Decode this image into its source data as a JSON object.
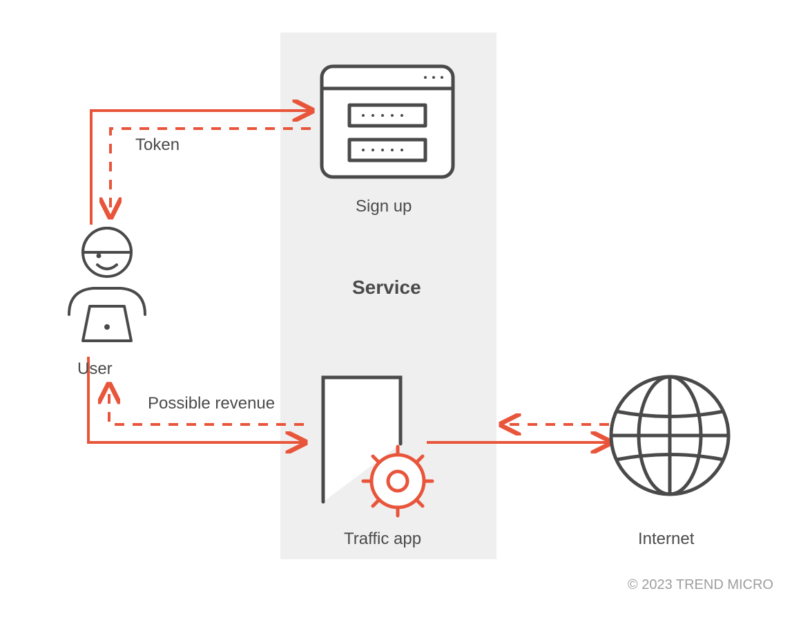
{
  "labels": {
    "user": "User",
    "token": "Token",
    "signup": "Sign up",
    "service": "Service",
    "possible_revenue": "Possible revenue",
    "traffic_app": "Traffic app",
    "internet": "Internet"
  },
  "copyright": "© 2023 TREND MICRO",
  "colors": {
    "accent": "#E8553A",
    "line_dark": "#4a4a4a",
    "bg_service": "#efefef"
  },
  "diagram": {
    "nodes": [
      {
        "id": "user",
        "label_key": "user"
      },
      {
        "id": "signup",
        "label_key": "signup"
      },
      {
        "id": "service_group",
        "label_key": "service"
      },
      {
        "id": "traffic_app",
        "label_key": "traffic_app"
      },
      {
        "id": "internet",
        "label_key": "internet"
      }
    ],
    "edges": [
      {
        "from": "user",
        "to": "signup",
        "style": "solid",
        "direction": "forward"
      },
      {
        "from": "signup",
        "to": "user",
        "style": "dashed",
        "label_key": "token",
        "direction": "forward"
      },
      {
        "from": "user",
        "to": "traffic_app",
        "style": "solid",
        "direction": "forward"
      },
      {
        "from": "traffic_app",
        "to": "user",
        "style": "dashed",
        "label_key": "possible_revenue",
        "direction": "forward"
      },
      {
        "from": "traffic_app",
        "to": "internet",
        "style": "solid",
        "direction": "both"
      },
      {
        "from": "internet",
        "to": "traffic_app",
        "style": "dashed",
        "direction": "forward"
      }
    ]
  }
}
